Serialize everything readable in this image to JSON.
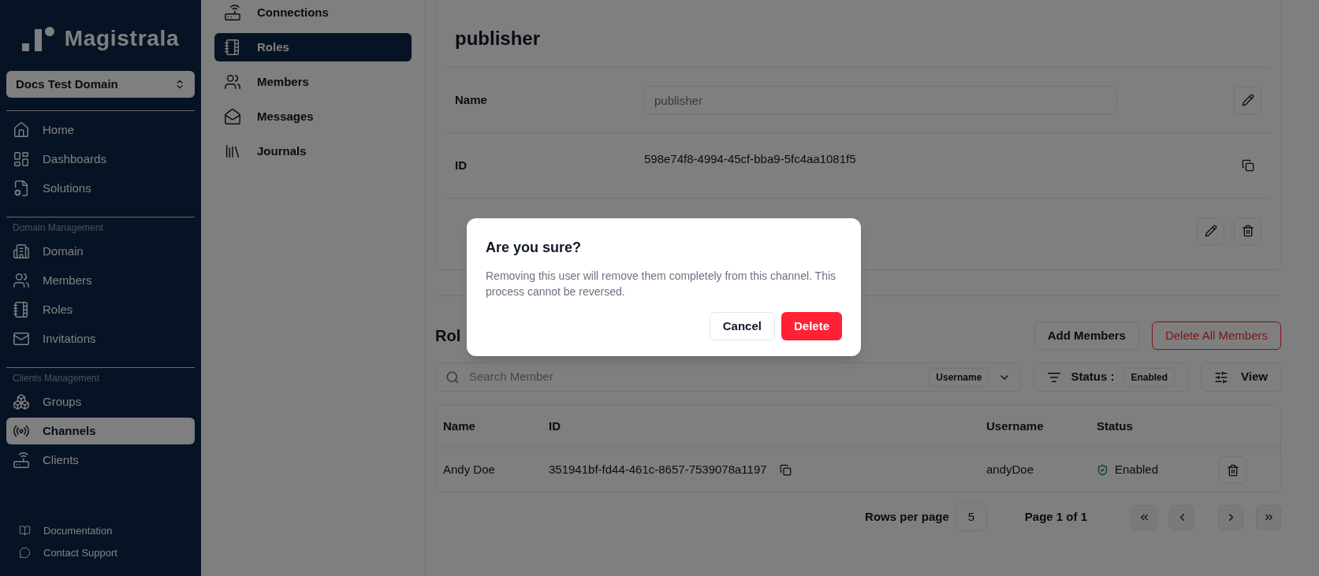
{
  "sidebar": {
    "logo": "Magistrala",
    "domain": "Docs Test Domain",
    "sections": [
      {
        "items": [
          {
            "label": "Home",
            "selected": false
          },
          {
            "label": "Dashboards",
            "selected": false
          },
          {
            "label": "Solutions",
            "selected": false
          }
        ]
      },
      {
        "title": "Domain Management",
        "items": [
          {
            "label": "Domain",
            "selected": false
          },
          {
            "label": "Members",
            "selected": false
          },
          {
            "label": "Roles",
            "selected": false
          },
          {
            "label": "Invitations",
            "selected": false
          }
        ]
      },
      {
        "title": "Clients Management",
        "items": [
          {
            "label": "Groups",
            "selected": false
          },
          {
            "label": "Channels",
            "selected": true
          },
          {
            "label": "Clients",
            "selected": false
          }
        ]
      }
    ],
    "footer": [
      {
        "label": "Documentation"
      },
      {
        "label": "Contact Support"
      }
    ]
  },
  "subnav": [
    {
      "label": "Connections",
      "selected": false
    },
    {
      "label": "Roles",
      "selected": true
    },
    {
      "label": "Members",
      "selected": false
    },
    {
      "label": "Messages",
      "selected": false
    },
    {
      "label": "Journals",
      "selected": false
    }
  ],
  "role": {
    "title": "publisher",
    "fields": [
      {
        "label": "Name",
        "kind": "input",
        "value": "publisher"
      },
      {
        "label": "ID",
        "kind": "copy",
        "value": "598e74f8-4994-45cf-bba9-5fc4aa1081f5"
      },
      {
        "kind": "actions"
      }
    ]
  },
  "members": {
    "heading": "Rol",
    "add_button": "Add Members",
    "delete_all_button": "Delete All Members",
    "search": {
      "placeholder": "Search Member",
      "filter": "Username"
    },
    "status_filter": {
      "label": "Status :",
      "value": "Enabled"
    },
    "view_button": "View",
    "table": {
      "columns": [
        "Name",
        "ID",
        "Username",
        "Status"
      ],
      "rows": [
        {
          "name": "Andy Doe",
          "id": "351941bf-fd44-461c-8657-7539078a1197",
          "username": "andyDoe",
          "status": "Enabled"
        }
      ]
    },
    "pagination": {
      "rows_label": "Rows per page",
      "rows_value": "5",
      "page": "Page 1 of 1"
    }
  },
  "dialog": {
    "title": "Are you sure?",
    "message": "Removing this user will remove them completely from this channel. This process cannot be reversed.",
    "cancel": "Cancel",
    "confirm": "Delete"
  }
}
